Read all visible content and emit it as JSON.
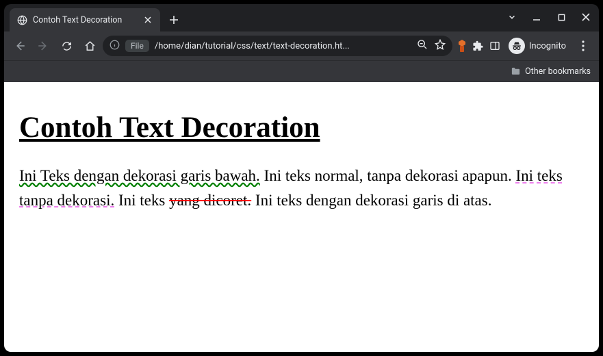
{
  "tab": {
    "title": "Contoh Text Decoration"
  },
  "addressbar": {
    "scheme_label": "File",
    "path": "/home/dian/tutorial/css/text/text-decoration.ht..."
  },
  "incognito": {
    "label": "Incognito"
  },
  "bookmarks": {
    "other_label": "Other bookmarks"
  },
  "page": {
    "heading": "Contoh Text Decoration",
    "span_underline_wavy": "Ini Teks dengan dekorasi garis bawah.",
    "span_normal1": " Ini teks normal, tanpa dekorasi apapun. ",
    "span_dashed_violet": "Ini teks tanpa dekorasi.",
    "span_normal2": " Ini teks ",
    "span_strike_red": "yang dicoret.",
    "span_normal3": " Ini teks dengan dekorasi garis di atas."
  }
}
